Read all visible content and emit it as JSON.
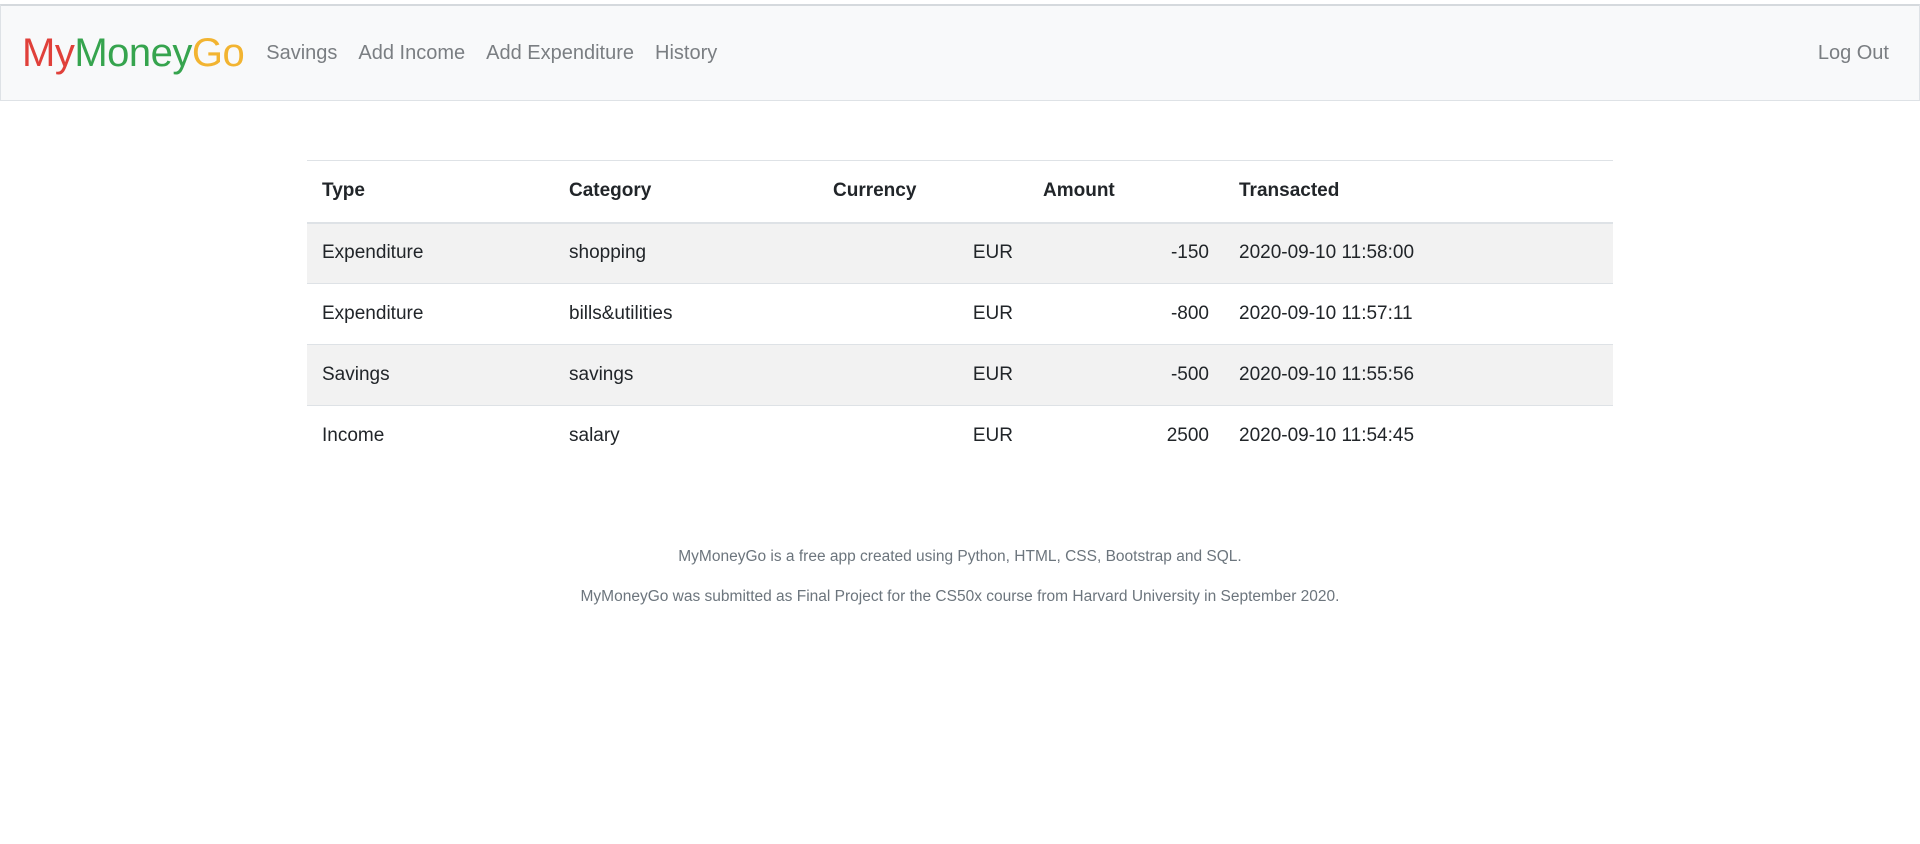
{
  "brand": {
    "part1": "My",
    "part2": "Money",
    "part3": "Go",
    "colors": {
      "my": "#e0403a",
      "money": "#36a44e",
      "go": "#f2b431"
    }
  },
  "nav": {
    "links": [
      "Savings",
      "Add Income",
      "Add Expenditure",
      "History"
    ],
    "logout": "Log Out"
  },
  "table": {
    "headers": [
      "Type",
      "Category",
      "Currency",
      "Amount",
      "Transacted"
    ],
    "rows": [
      [
        "Expenditure",
        "shopping",
        "EUR",
        "-150",
        "2020-09-10 11:58:00"
      ],
      [
        "Expenditure",
        "bills&utilities",
        "EUR",
        "-800",
        "2020-09-10 11:57:11"
      ],
      [
        "Savings",
        "savings",
        "EUR",
        "-500",
        "2020-09-10 11:55:56"
      ],
      [
        "Income",
        "salary",
        "EUR",
        "2500",
        "2020-09-10 11:54:45"
      ]
    ]
  },
  "footer": {
    "line1": "MyMoneyGo is a free app created using Python, HTML, CSS, Bootstrap and SQL.",
    "line2": "MyMoneyGo was submitted as Final Project for the CS50x course from Harvard University in September 2020."
  }
}
